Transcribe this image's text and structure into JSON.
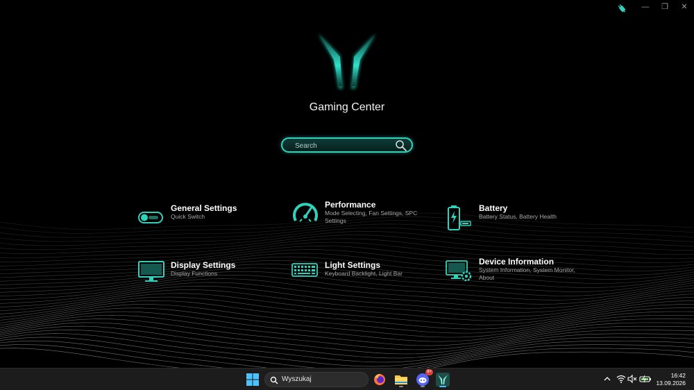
{
  "app": {
    "title": "Gaming Center",
    "accent": "#2fd3bd",
    "window_controls": [
      "—",
      "❐",
      "✕"
    ]
  },
  "search": {
    "placeholder": "Search"
  },
  "tiles": [
    {
      "title": "General Settings",
      "subtitle": "Quick Switch",
      "icon": "toggle-icon"
    },
    {
      "title": "Performance",
      "subtitle": "Mode Selecting, Fan Settings, SPC Settings",
      "icon": "speedometer-icon"
    },
    {
      "title": "Battery",
      "subtitle": "Battery Status, Battery Health",
      "icon": "battery-icon"
    },
    {
      "title": "Display Settings",
      "subtitle": "Display Functions",
      "icon": "monitor-icon"
    },
    {
      "title": "Light Settings",
      "subtitle": "Keyboard Backlight, Light Bar",
      "icon": "keyboard-icon"
    },
    {
      "title": "Device Information",
      "subtitle": "System Information, System Monitor, About",
      "icon": "device-gear-icon"
    }
  ],
  "taskbar": {
    "search_label": "Wyszukaj",
    "discord_badge": "9+",
    "time": "16:42",
    "date": "13.09.2026"
  }
}
